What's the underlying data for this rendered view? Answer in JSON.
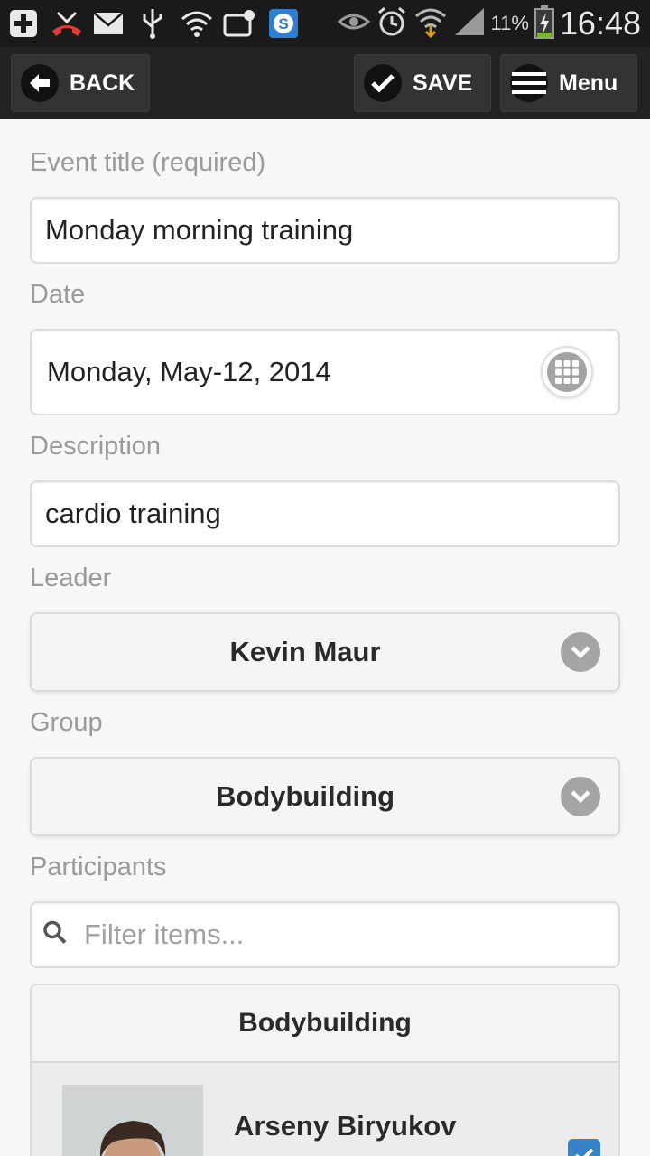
{
  "status_bar": {
    "battery_percent": "11%",
    "time": "16:48"
  },
  "header": {
    "back_label": "BACK",
    "save_label": "SAVE",
    "menu_label": "Menu"
  },
  "form": {
    "event_title_label": "Event title (required)",
    "event_title_value": "Monday morning training",
    "date_label": "Date",
    "date_value": "Monday, May-12, 2014",
    "description_label": "Description",
    "description_value": "cardio training",
    "leader_label": "Leader",
    "leader_value": "Kevin Maur",
    "group_label": "Group",
    "group_value": "Bodybuilding",
    "participants_label": "Participants",
    "filter_placeholder": "Filter items..."
  },
  "participants": {
    "group_header": "Bodybuilding",
    "items": [
      {
        "name": "Arseny Biryukov",
        "checked": true
      }
    ]
  },
  "colors": {
    "accent": "#3a82c8",
    "header_bg": "#222222",
    "page_bg": "#f7f7f7"
  }
}
